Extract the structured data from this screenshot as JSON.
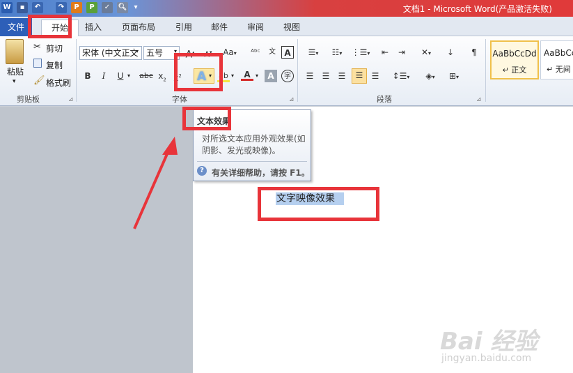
{
  "window": {
    "title": "文档1 - Microsoft Word(产品激活失败)"
  },
  "quick_access": {
    "icons": [
      "word-logo-icon",
      "save-icon",
      "undo-icon",
      "redo-icon",
      "p-icon",
      "p2-icon",
      "spell-icon",
      "print-preview-icon",
      "customize-icon"
    ]
  },
  "tabs": [
    "文件",
    "开始",
    "插入",
    "页面布局",
    "引用",
    "邮件",
    "审阅",
    "视图"
  ],
  "clipboard": {
    "paste": "粘贴",
    "cut": "剪切",
    "copy": "复制",
    "format_painter": "格式刷",
    "label": "剪贴板"
  },
  "font": {
    "name": "宋体 (中文正文",
    "size": "五号",
    "label": "字体",
    "grow": "A",
    "shrink": "A",
    "case": "Aa",
    "bold": "B",
    "italic": "I",
    "underline": "U",
    "strike": "abc",
    "subscript": "x",
    "superscript": "x",
    "text_effect": "A",
    "highlight": "ab",
    "font_color": "A",
    "char_shading": "A",
    "phonetic": "文",
    "clear": "A",
    "enclosed": "字"
  },
  "paragraph": {
    "label": "段落"
  },
  "styles": {
    "items": [
      "AaBbCcDd",
      "AaBbCcDd"
    ],
    "names": [
      "↵ 正文",
      "↵ 无间"
    ]
  },
  "tooltip": {
    "title": "文本效果",
    "body": "对所选文本应用外观效果(如阴影、发光或映像)。",
    "help": "有关详细帮助，请按 F1。",
    "help_icon": "?"
  },
  "document": {
    "selected_text": "文字映像效果"
  },
  "watermark": {
    "brand": "Bai 经验",
    "site": "jingyan.baidu.com"
  }
}
